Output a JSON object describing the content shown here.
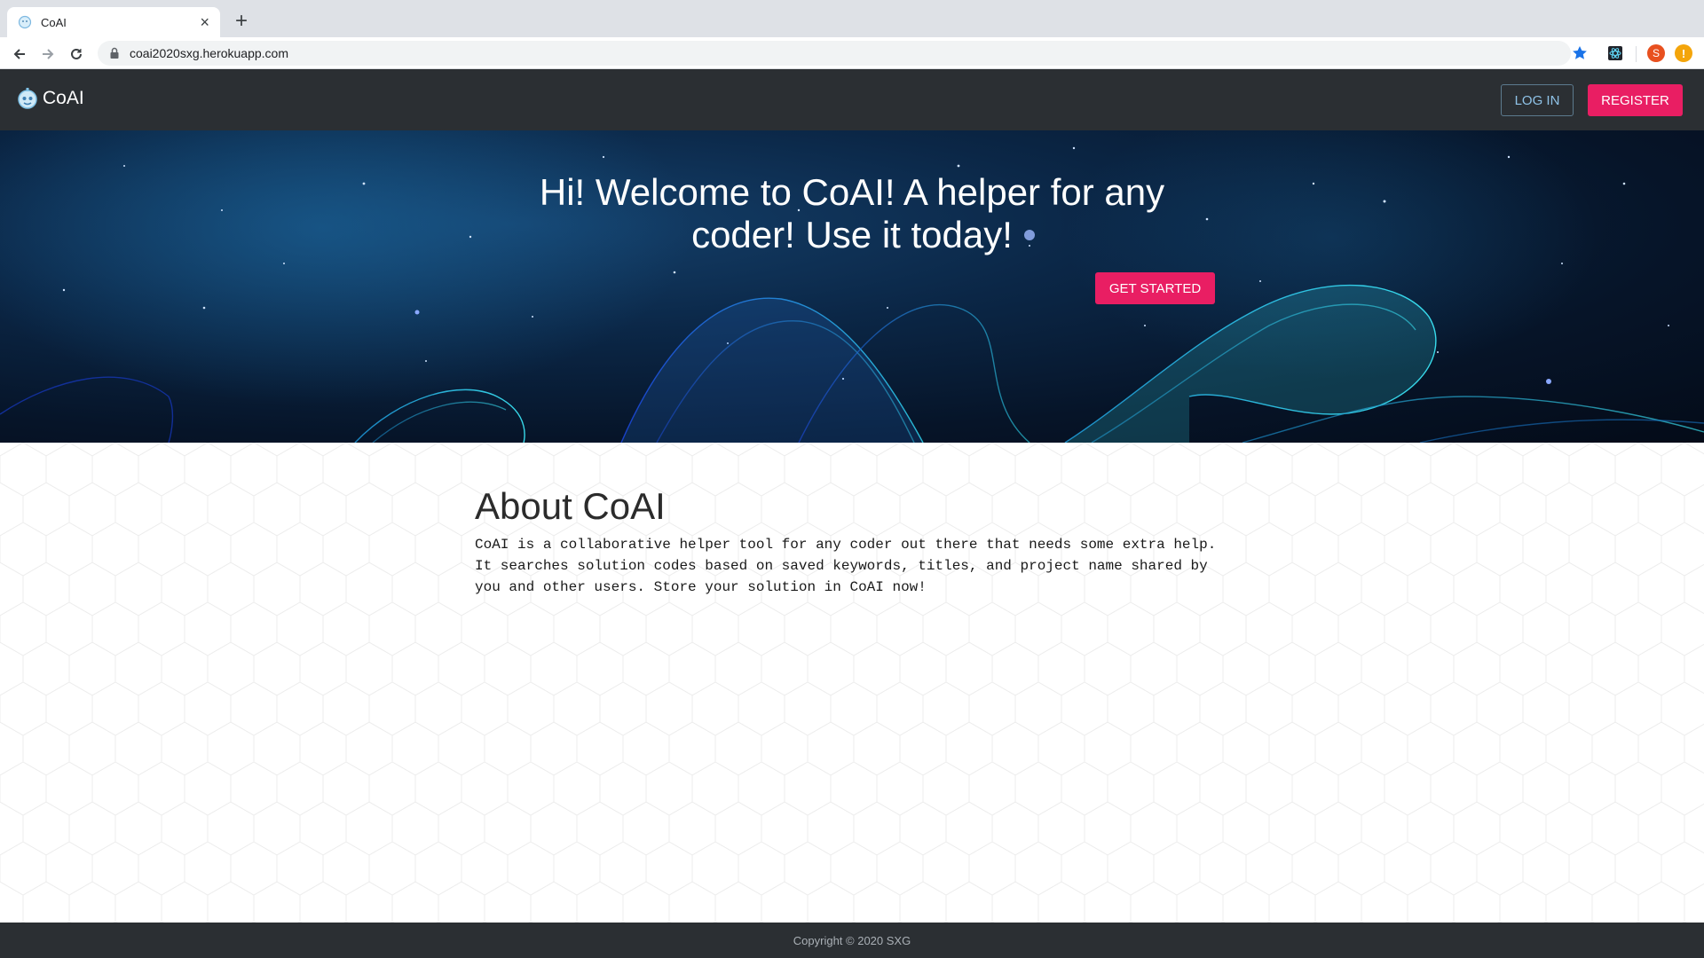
{
  "browser": {
    "tab_title": "CoAI",
    "close_glyph": "×",
    "new_tab_glyph": "+",
    "url": "coai2020sxg.herokuapp.com",
    "profile_initial": "S",
    "alert_glyph": "!"
  },
  "site": {
    "brand": "CoAI",
    "nav": {
      "login_label": "LOG IN",
      "register_label": "REGISTER"
    },
    "hero": {
      "title": "Hi! Welcome to CoAI! A helper for any coder! Use it today!",
      "cta_label": "GET STARTED"
    },
    "about": {
      "title": "About CoAI",
      "text": "CoAI is a collaborative helper tool for any coder out there that needs some extra help. It searches solution codes based on saved keywords, titles, and project name shared by you and other users. Store your solution in CoAI now!"
    },
    "footer": "Copyright © 2020 SXG"
  },
  "colors": {
    "nav_bg": "#2b2f33",
    "accent_pink": "#e91e63",
    "login_text": "#8fc3e8",
    "hero_wave": "#2fd6e8"
  },
  "icons": [
    "back-arrow-icon",
    "forward-arrow-icon",
    "reload-icon",
    "lock-icon",
    "star-icon",
    "extension-icon",
    "coai-logo-icon"
  ]
}
